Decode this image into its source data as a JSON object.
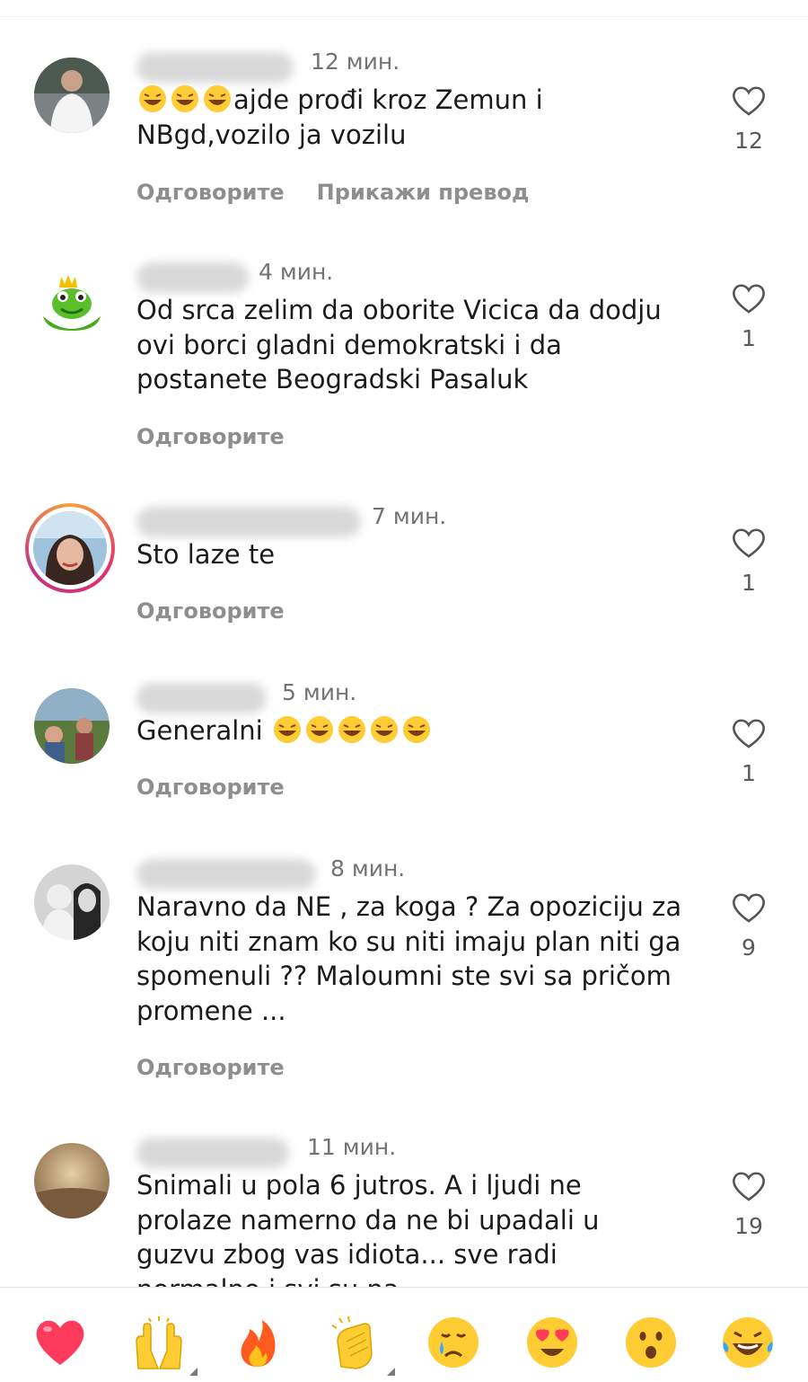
{
  "comments": [
    {
      "time": "12 мин.",
      "text": "ajde prođi kroz Zemun i NBgd,vozilo ja vozilu",
      "reply": "Одговорите",
      "translate": "Прикажи превод",
      "likes": "12",
      "leading_emoji": "laughing-tears-emoji"
    },
    {
      "time": "4 мин.",
      "text": "Od srca zelim da oborite Vicica da dodju ovi borci gladni demokratski i da postanete Beogradski Pasaluk",
      "reply": "Одговорите",
      "likes": "1"
    },
    {
      "time": "7 мин.",
      "text": "Sto laze te",
      "reply": "Одговорите",
      "likes": "1"
    },
    {
      "time": "5 мин.",
      "text": "Generalni ",
      "reply": "Одговорите",
      "likes": "1",
      "trailing_emoji": "laughing-tears-emoji"
    },
    {
      "time": "8 мин.",
      "text": "Naravno da NE , za koga ? Za opoziciju za koju niti znam ko su niti imaju plan niti ga spomenuli ?? Maloumni ste svi sa pričom promene ...",
      "reply": "Одговорите",
      "likes": "9"
    },
    {
      "time": "11 мин.",
      "text": "Snimali u pola 6 jutros. A i ljudi ne prolaze namerno da ne bi upadali u guzvu zbog vas idiota... sve radi normalno i svi su na",
      "likes": "19"
    }
  ],
  "reactions": [
    "red-heart",
    "raising-hands",
    "fire",
    "clapping-hands",
    "crying-face",
    "heart-eyes",
    "surprised-face",
    "laughing-tears"
  ],
  "colors": {
    "text": "#1b1b1b",
    "muted": "#8e8e8e",
    "time": "#737373",
    "heart": "#ff3b5c",
    "emoji": "#ffcc33"
  }
}
